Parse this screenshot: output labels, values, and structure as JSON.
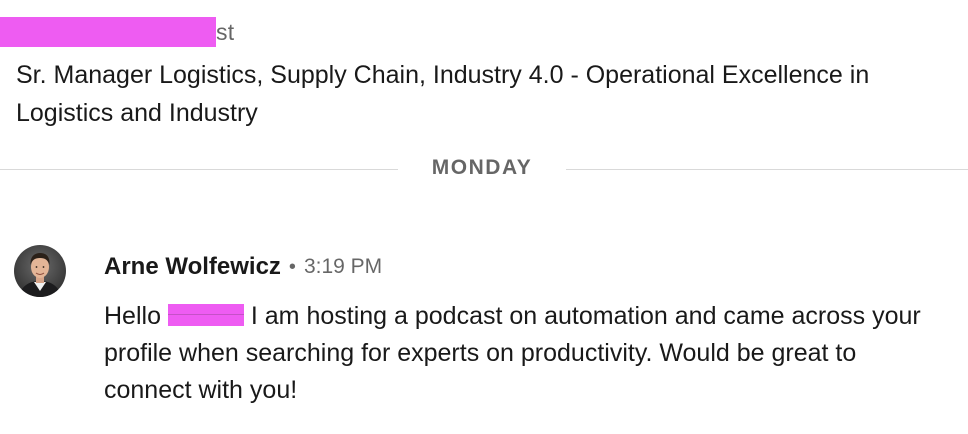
{
  "profile": {
    "name_visible_suffix": "st",
    "headline": "Sr. Manager Logistics, Supply Chain, Industry 4.0 - Operational Excellence in Logistics and Industry",
    "redaction_color": "#ee5cf2"
  },
  "divider": {
    "label": "MONDAY"
  },
  "message": {
    "sender": "Arne Wolfewicz",
    "separator": "•",
    "time": "3:19 PM",
    "body_prefix": "Hello",
    "body_rest": "I am hosting a podcast on automation and came across your profile when searching for experts on productivity. Would be great to connect with you!"
  },
  "icons": {
    "avatar": "person-avatar"
  }
}
